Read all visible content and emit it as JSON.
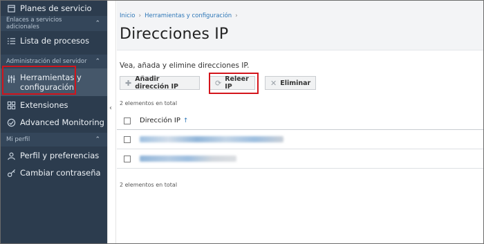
{
  "sidebar": {
    "top_item": "Planes de servicio",
    "section1": "Enlaces a servicios adicionales",
    "item_processes": "Lista de procesos",
    "section2": "Administración del servidor",
    "item_tools_line1": "Herramientas y",
    "item_tools_line2": "configuración",
    "item_extensions": "Extensiones",
    "item_monitoring": "Advanced Monitoring",
    "section3": "Mi perfil",
    "item_profile": "Perfil y preferencias",
    "item_password": "Cambiar contraseña"
  },
  "breadcrumb": {
    "home": "Inicio",
    "tools": "Herramientas y configuración"
  },
  "page": {
    "title": "Direcciones IP",
    "description": "Vea, añada y elimine direcciones IP."
  },
  "toolbar": {
    "add_label": "Añadir dirección IP",
    "reread_label": "Releer IP",
    "delete_label": "Eliminar"
  },
  "table": {
    "count_label": "2 elementos en total",
    "column_ip": "Dirección IP",
    "sort_indicator": "↑"
  },
  "icons": {
    "chevron_up": "⌃",
    "collapse_arrow": "‹",
    "breadcrumb_sep": "›"
  },
  "colors": {
    "sidebar_bg": "#2c3c4e",
    "link": "#2c76b7",
    "highlight": "#d3141b"
  }
}
